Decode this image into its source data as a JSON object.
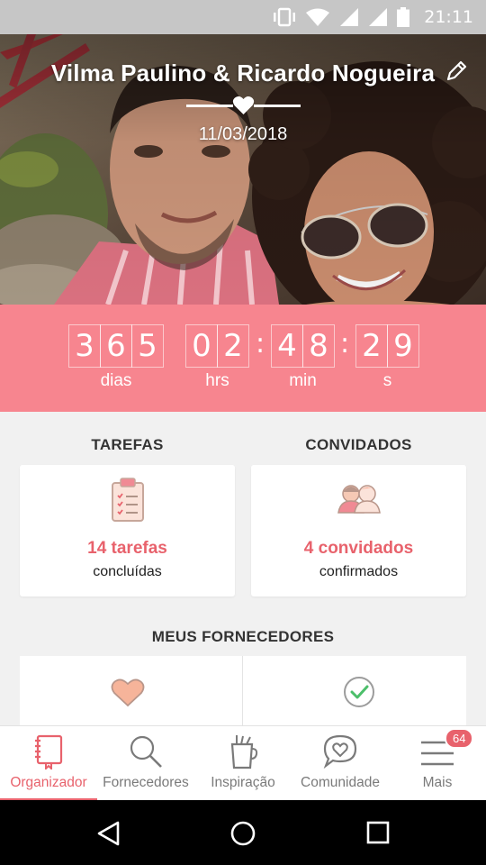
{
  "status_bar": {
    "time": "21:11",
    "icons": [
      "vibrate-icon",
      "wifi-icon",
      "signal-icon",
      "signal-icon",
      "battery-icon"
    ]
  },
  "hero": {
    "couple_names": "Vilma Paulino & Ricardo Nogueira",
    "wedding_date": "11/03/2018",
    "icons": [
      "edit-icon",
      "heart-icon"
    ]
  },
  "countdown": {
    "days_digits": [
      "3",
      "6",
      "5"
    ],
    "hours_digits": [
      "0",
      "2"
    ],
    "minutes_digits": [
      "4",
      "8"
    ],
    "seconds_digits": [
      "2",
      "9"
    ],
    "separator": ":",
    "days_label": "dias",
    "hours_label": "hrs",
    "minutes_label": "min",
    "seconds_label": "s"
  },
  "tasks": {
    "title": "TAREFAS",
    "count": "14 tarefas",
    "status": "concluídas",
    "icon": "clipboard-icon"
  },
  "guests": {
    "title": "CONVIDADOS",
    "count": "4 convidados",
    "status": "confirmados",
    "icon": "guests-icon"
  },
  "vendors": {
    "title": "MEUS FORNECEDORES",
    "icons": [
      "heart-icon",
      "check-circle-icon"
    ]
  },
  "bottom_nav": {
    "items": [
      {
        "label": "Organizador",
        "icon": "notebook-icon",
        "active": true
      },
      {
        "label": "Fornecedores",
        "icon": "search-icon",
        "active": false
      },
      {
        "label": "Inspiração",
        "icon": "cup-icon",
        "active": false
      },
      {
        "label": "Comunidade",
        "icon": "chat-heart-icon",
        "active": false
      },
      {
        "label": "Mais",
        "icon": "menu-icon",
        "active": false
      }
    ],
    "badge": "64"
  },
  "colors": {
    "accent": "#e8626c",
    "countdown_bg": "#f7858f",
    "peach": "#f6b49a"
  }
}
